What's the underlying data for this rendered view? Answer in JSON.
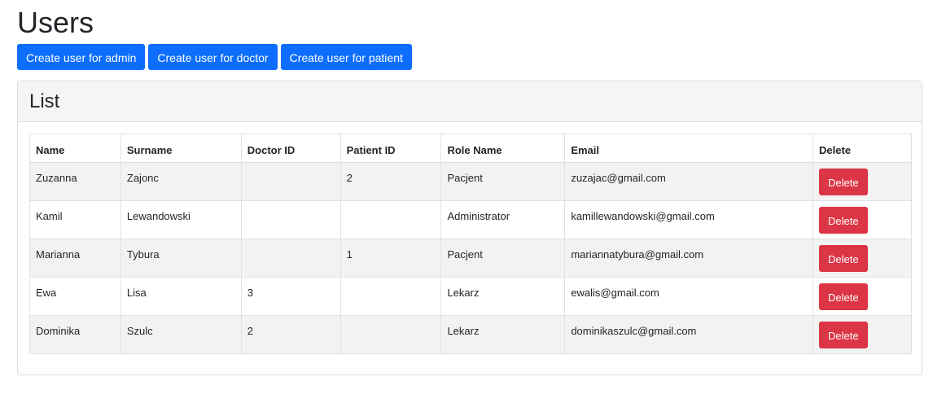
{
  "page": {
    "title": "Users"
  },
  "actions": [
    {
      "label": "Create user for admin"
    },
    {
      "label": "Create user for doctor"
    },
    {
      "label": "Create user for patient"
    }
  ],
  "list": {
    "title": "List",
    "columns": [
      "Name",
      "Surname",
      "Doctor ID",
      "Patient ID",
      "Role Name",
      "Email",
      "Delete"
    ],
    "rows": [
      {
        "name": "Zuzanna",
        "surname": "Zajonc",
        "doctor_id": "",
        "patient_id": "2",
        "role": "Pacjent",
        "email": "zuzajac@gmail.com",
        "delete_label": "Delete"
      },
      {
        "name": "Kamil",
        "surname": "Lewandowski",
        "doctor_id": "",
        "patient_id": "",
        "role": "Administrator",
        "email": "kamillewandowski@gmail.com",
        "delete_label": "Delete"
      },
      {
        "name": "Marianna",
        "surname": "Tybura",
        "doctor_id": "",
        "patient_id": "1",
        "role": "Pacjent",
        "email": "mariannatybura@gmail.com",
        "delete_label": "Delete"
      },
      {
        "name": "Ewa",
        "surname": "Lisa",
        "doctor_id": "3",
        "patient_id": "",
        "role": "Lekarz",
        "email": "ewalis@gmail.com",
        "delete_label": "Delete"
      },
      {
        "name": "Dominika",
        "surname": "Szulc",
        "doctor_id": "2",
        "patient_id": "",
        "role": "Lekarz",
        "email": "dominikaszulc@gmail.com",
        "delete_label": "Delete"
      }
    ]
  },
  "colors": {
    "primary": "#0d6efd",
    "danger": "#dc3545",
    "striped_row": "#f2f2f2",
    "card_header": "#f5f5f5"
  }
}
